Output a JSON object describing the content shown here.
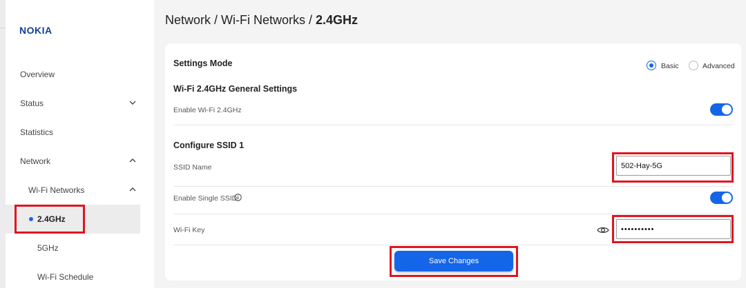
{
  "brand": {
    "logo_text": "NOKIA",
    "logo_color": "#124191",
    "accent_color": "#1565e8",
    "highlight_color": "#e0141e"
  },
  "sidebar": {
    "items": [
      {
        "label": "Overview"
      },
      {
        "label": "Status",
        "icon": "chevron-down-icon"
      },
      {
        "label": "Statistics"
      },
      {
        "label": "Network",
        "icon": "chevron-up-icon"
      },
      {
        "label": "Wi-Fi Networks",
        "icon": "chevron-up-icon"
      },
      {
        "label": "2.4GHz",
        "active": true
      },
      {
        "label": "5GHz"
      },
      {
        "label": "Wi-Fi Schedule"
      }
    ]
  },
  "breadcrumb": {
    "part1": "Network / Wi-Fi Networks / ",
    "current": "2.4GHz"
  },
  "settings_mode": {
    "title": "Settings Mode",
    "options": [
      "Basic",
      "Advanced"
    ],
    "selected": "Basic"
  },
  "general": {
    "title": "Wi-Fi 2.4GHz General Settings",
    "enable_label": "Enable Wi-Fi 2.4GHz",
    "enable_value": true
  },
  "ssid": {
    "title": "Configure SSID 1",
    "name_label": "SSID Name",
    "name_value": "502-Hay-5G",
    "single_label": "Enable Single SSID",
    "single_value": true,
    "key_label": "Wi-Fi Key",
    "key_value": "••••••••••"
  },
  "actions": {
    "save_label": "Save Changes"
  }
}
